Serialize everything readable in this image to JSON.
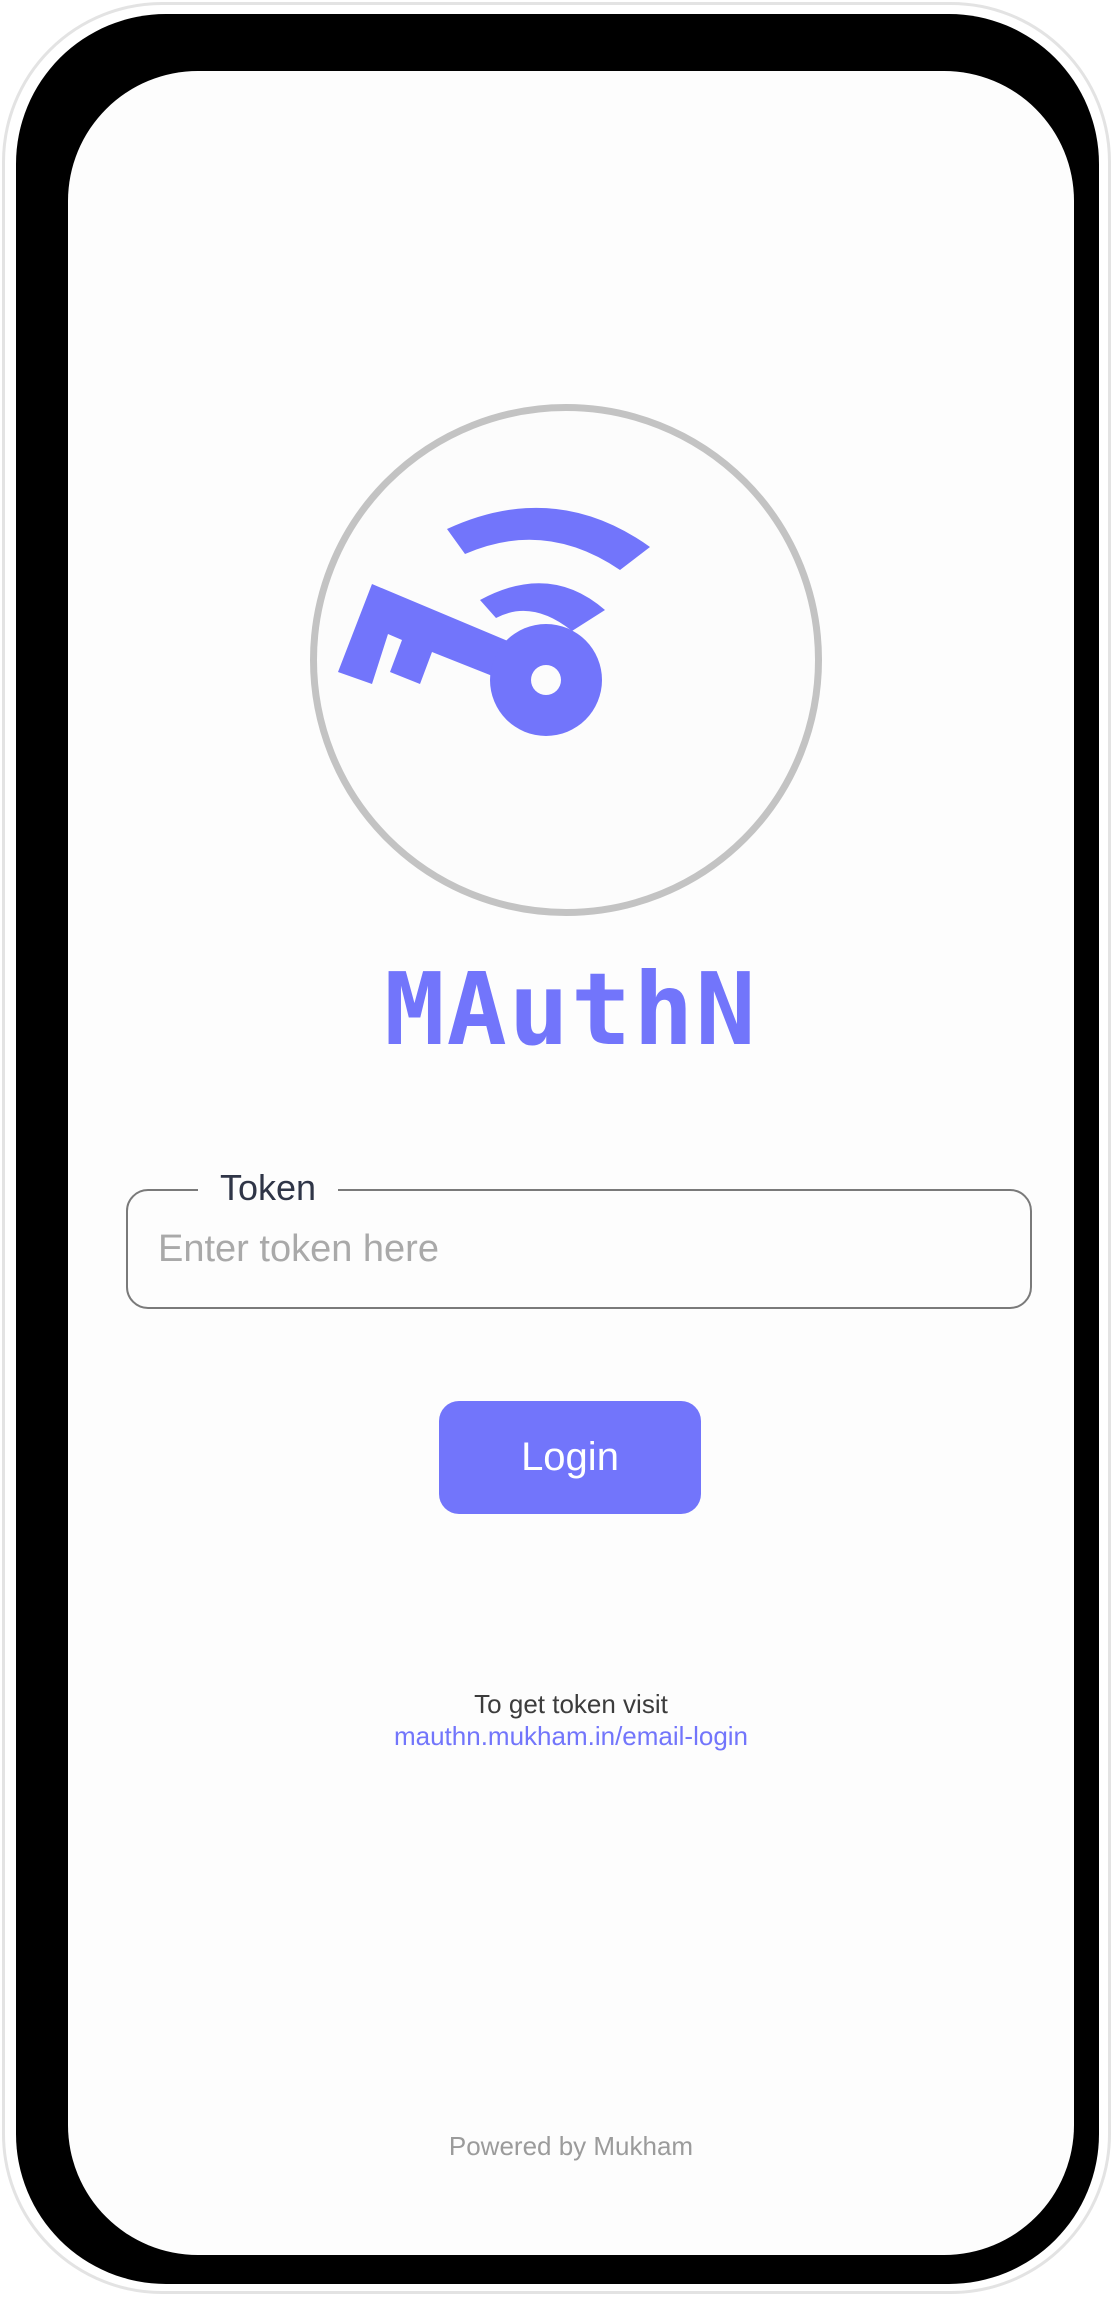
{
  "app": {
    "brand_name": "MAuthN",
    "logo_icon": "key-wifi-icon",
    "accent_color": "#7275fb"
  },
  "form": {
    "token_label": "Token",
    "token_placeholder": "Enter token here",
    "token_value": "",
    "login_label": "Login"
  },
  "help": {
    "text": "To get token visit",
    "link_text": "mauthn.mukham.in/email-login"
  },
  "footer": {
    "text": "Powered by Mukham"
  }
}
